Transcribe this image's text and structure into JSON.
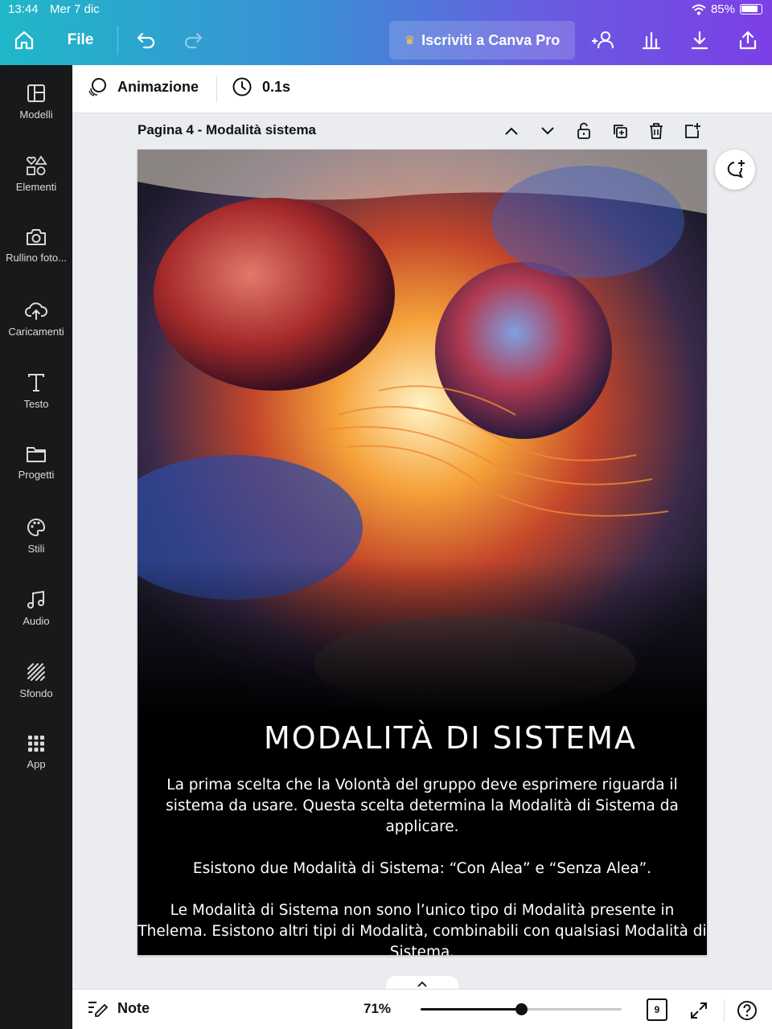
{
  "status": {
    "time": "13:44",
    "date": "Mer 7 dic",
    "battery": "85%"
  },
  "topbar": {
    "file_label": "File",
    "pro_label": "Iscriviti a Canva Pro"
  },
  "sidebar": {
    "items": [
      {
        "label": "Modelli",
        "icon": "templates-icon"
      },
      {
        "label": "Elementi",
        "icon": "elements-icon"
      },
      {
        "label": "Rullino foto...",
        "icon": "camera-icon"
      },
      {
        "label": "Caricamenti",
        "icon": "upload-cloud-icon"
      },
      {
        "label": "Testo",
        "icon": "text-icon"
      },
      {
        "label": "Progetti",
        "icon": "folder-icon"
      },
      {
        "label": "Stili",
        "icon": "palette-icon"
      },
      {
        "label": "Audio",
        "icon": "music-note-icon"
      },
      {
        "label": "Sfondo",
        "icon": "background-icon"
      },
      {
        "label": "App",
        "icon": "apps-grid-icon"
      }
    ]
  },
  "toolbar": {
    "animation_label": "Animazione",
    "duration_label": "0.1s"
  },
  "page": {
    "title": "Pagina 4 - Modalità sistema"
  },
  "canvas": {
    "heading": "MODALITÀ DI SISTEMA",
    "paragraphs": [
      "La prima scelta che la Volontà del gruppo deve esprimere riguarda il sistema da usare. Questa scelta determina la Modalità di Sistema da applicare.",
      "Esistono due Modalità di Sistema: “Con Alea” e “Senza Alea”.",
      "Le Modalità di Sistema non sono l’unico tipo di Modalità presente in Thelema. Esistono altri tipi di Modalità, combinabili con qualsiasi Modalità di Sistema."
    ]
  },
  "bottombar": {
    "note_label": "Note",
    "zoom_label": "71%",
    "zoom_level": 0.71,
    "page_count": "9"
  },
  "colors": {
    "sidebar_bg": "#18191b",
    "gradient_start": "#1fb8c8",
    "gradient_end": "#7c3fe6",
    "canvas_bg": "#000000"
  }
}
